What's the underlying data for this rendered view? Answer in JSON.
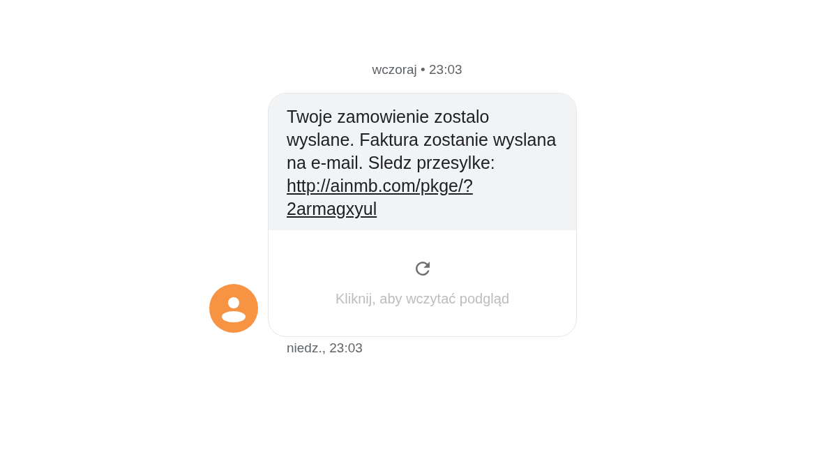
{
  "date_header": "wczoraj • 23:03",
  "message": {
    "text": "Twoje zamowienie zostalo wyslane. Faktura zostanie wyslana na e-mail. Sledz przesylke:",
    "link": "http://ainmb.com/pkge/?2armagxyul",
    "preview_hint": "Kliknij, aby wczytać podgląd",
    "time": "niedz., 23:03"
  }
}
